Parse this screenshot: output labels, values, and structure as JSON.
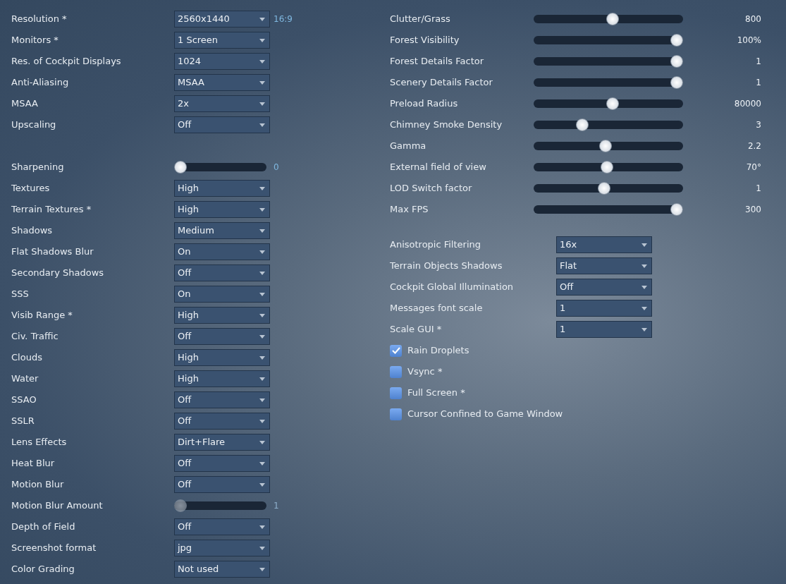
{
  "display": [
    {
      "kind": "dropdown",
      "label": "Resolution *",
      "value": "2560x1440",
      "aspect": "16:9"
    },
    {
      "kind": "dropdown",
      "label": "Monitors *",
      "value": "1 Screen"
    },
    {
      "kind": "dropdown",
      "label": "Res. of Cockpit Displays",
      "value": "1024"
    },
    {
      "kind": "dropdown",
      "label": "Anti-Aliasing",
      "value": "MSAA"
    },
    {
      "kind": "dropdown",
      "label": "MSAA",
      "value": "2x"
    },
    {
      "kind": "dropdown",
      "label": "Upscaling",
      "value": "Off"
    }
  ],
  "graphics": [
    {
      "kind": "slider",
      "label": "Sharpening",
      "level": 0,
      "reading": "0",
      "disabled": false
    },
    {
      "kind": "dropdown",
      "label": "Textures",
      "value": "High"
    },
    {
      "kind": "dropdown",
      "label": "Terrain Textures *",
      "value": "High"
    },
    {
      "kind": "dropdown",
      "label": "Shadows",
      "value": "Medium"
    },
    {
      "kind": "dropdown",
      "label": "Flat Shadows Blur",
      "value": "On"
    },
    {
      "kind": "dropdown",
      "label": "Secondary Shadows",
      "value": "Off"
    },
    {
      "kind": "dropdown",
      "label": "SSS",
      "value": "On"
    },
    {
      "kind": "dropdown",
      "label": "Visib Range *",
      "value": "High"
    },
    {
      "kind": "dropdown",
      "label": "Civ. Traffic",
      "value": "Off"
    },
    {
      "kind": "dropdown",
      "label": "Clouds",
      "value": "High"
    },
    {
      "kind": "dropdown",
      "label": "Water",
      "value": "High"
    },
    {
      "kind": "dropdown",
      "label": "SSAO",
      "value": "Off"
    },
    {
      "kind": "dropdown",
      "label": "SSLR",
      "value": "Off"
    },
    {
      "kind": "dropdown",
      "label": "Lens Effects",
      "value": "Dirt+Flare"
    },
    {
      "kind": "dropdown",
      "label": "Heat Blur",
      "value": "Off"
    },
    {
      "kind": "dropdown",
      "label": "Motion Blur",
      "value": "Off"
    },
    {
      "kind": "slider",
      "label": "Motion Blur Amount",
      "level": 0,
      "reading": "1",
      "disabled": true
    },
    {
      "kind": "dropdown",
      "label": "Depth of Field",
      "value": "Off"
    },
    {
      "kind": "dropdown",
      "label": "Screenshot format",
      "value": "jpg"
    },
    {
      "kind": "dropdown",
      "label": "Color Grading",
      "value": "Not used"
    }
  ],
  "sliders": [
    {
      "label": "Clutter/Grass",
      "level": 0.53,
      "reading": "800"
    },
    {
      "label": "Forest Visibility",
      "level": 1,
      "reading": "100%"
    },
    {
      "label": "Forest Details Factor",
      "level": 1,
      "reading": "1"
    },
    {
      "label": "Scenery Details Factor",
      "level": 1,
      "reading": "1"
    },
    {
      "label": "Preload Radius",
      "level": 0.53,
      "reading": "80000"
    },
    {
      "label": "Chimney Smoke Density",
      "level": 0.31,
      "reading": "3"
    },
    {
      "label": "Gamma",
      "level": 0.48,
      "reading": "2.2"
    },
    {
      "label": "External field of view",
      "level": 0.49,
      "reading": "70°"
    },
    {
      "label": "LOD Switch factor",
      "level": 0.47,
      "reading": "1"
    },
    {
      "label": "Max FPS",
      "level": 1,
      "reading": "300"
    }
  ],
  "options": [
    {
      "label": "Anisotropic Filtering",
      "value": "16x"
    },
    {
      "label": "Terrain Objects Shadows",
      "value": "Flat"
    },
    {
      "label": "Cockpit Global Illumination",
      "value": "Off"
    },
    {
      "label": "Messages font scale",
      "value": "1"
    },
    {
      "label": "Scale GUI *",
      "value": "1"
    }
  ],
  "checkboxes": [
    {
      "label": "Rain Droplets",
      "checked": true
    },
    {
      "label": "Vsync *",
      "checked": false
    },
    {
      "label": "Full Screen *",
      "checked": false
    },
    {
      "label": "Cursor Confined to Game Window",
      "checked": false
    }
  ]
}
